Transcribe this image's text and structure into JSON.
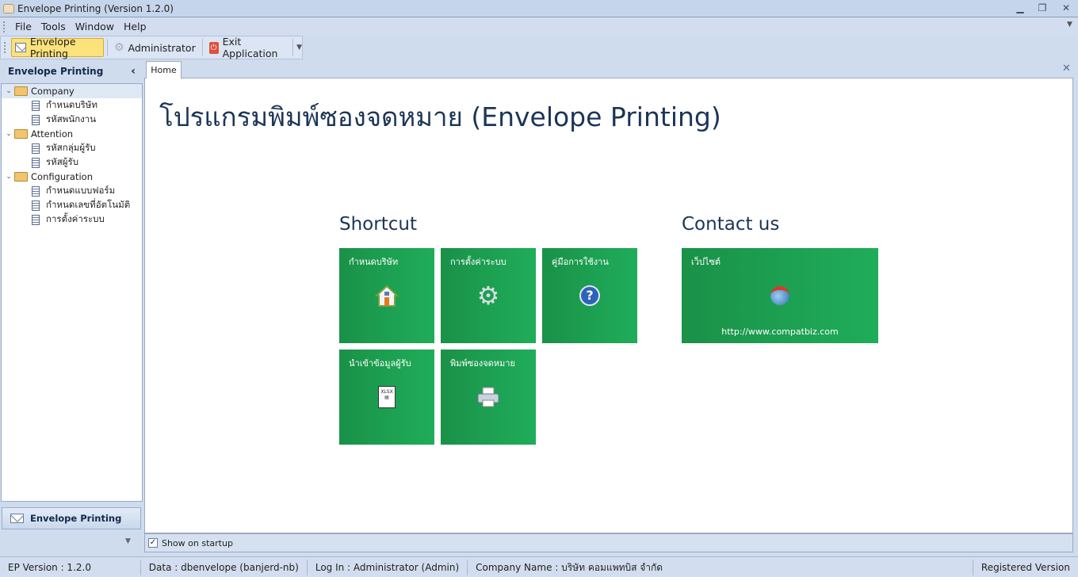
{
  "window": {
    "title": "Envelope Printing (Version 1.2.0)"
  },
  "menu": [
    "File",
    "Tools",
    "Window",
    "Help"
  ],
  "toolbar": {
    "envelope_printing": "Envelope Printing",
    "administrator": "Administrator",
    "exit": "Exit Application"
  },
  "sidebar": {
    "title": "Envelope Printing",
    "groups": [
      {
        "label": "Company",
        "items": [
          "กำหนดบริษัท",
          "รหัสพนักงาน"
        ]
      },
      {
        "label": "Attention",
        "items": [
          "รหัสกลุ่มผู้รับ",
          "รหัสผู้รับ"
        ]
      },
      {
        "label": "Configuration",
        "items": [
          "กำหนดแบบฟอร์ม",
          "กำหนดเลขที่อัตโนมัติ",
          "การตั้งค่าระบบ"
        ]
      }
    ],
    "nav_button": "Envelope Printing"
  },
  "tabs": [
    {
      "label": "Home"
    }
  ],
  "home": {
    "title": "โปรแกรมพิมพ์ซองจดหมาย (Envelope Printing)",
    "shortcut_heading": "Shortcut",
    "contact_heading": "Contact us",
    "shortcuts": [
      {
        "label": "กำหนดบริษัท",
        "icon": "house-icon"
      },
      {
        "label": "การตั้งค่าระบบ",
        "icon": "gear-icon"
      },
      {
        "label": "คู่มือการใช้งาน",
        "icon": "help-icon"
      },
      {
        "label": "นำเข้าข้อมูลผู้รับ",
        "icon": "xlsx-import-icon"
      },
      {
        "label": "พิมพ์ซองจดหมาย",
        "icon": "printer-icon"
      }
    ],
    "contact": {
      "label": "เว็ปไซต์",
      "url": "http://www.compatbiz.com",
      "icon": "globe-icon"
    },
    "tile_color": "#1fa555"
  },
  "show_on_startup": {
    "label": "Show on startup",
    "checked": true
  },
  "status": {
    "version": "EP Version : 1.2.0",
    "data": "Data : dbenvelope (banjerd-nb)",
    "login": "Log In : Administrator (Admin)",
    "company": "Company Name : บริษัท คอมแพทบิส จำกัด",
    "registered": "Registered Version"
  }
}
